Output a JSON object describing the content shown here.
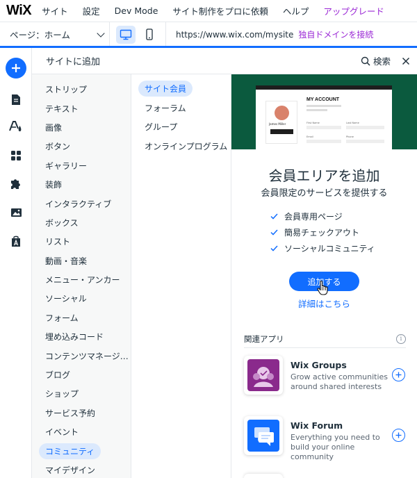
{
  "topbar": {
    "logo": "WiX",
    "menu": [
      "サイト",
      "設定",
      "Dev Mode",
      "サイト制作をプロに依頼",
      "ヘルプ"
    ],
    "upgrade_label": "アップグレード",
    "upgrade_color": "#9a27d5"
  },
  "secondbar": {
    "page_label": "ページ：ホーム",
    "url": "https://www.wix.com/mysite",
    "domain_link": "独自ドメインを接続",
    "active_device": "desktop"
  },
  "accent_color": "#116dff",
  "left_tools": [
    "plus-icon",
    "pages-icon",
    "design-icon",
    "add-apps-icon",
    "puzzle-icon",
    "media-icon",
    "app-market-icon"
  ],
  "panel": {
    "title": "サイトに追加",
    "search_label": "検索",
    "categories": [
      "ストリップ",
      "テキスト",
      "画像",
      "ボタン",
      "ギャラリー",
      "装飾",
      "インタラクティブ",
      "ボックス",
      "リスト",
      "動画・音楽",
      "メニュー・アンカー",
      "ソーシャル",
      "フォーム",
      "埋め込みコード",
      "コンテンツマネージ…",
      "ブログ",
      "ショップ",
      "サービス予約",
      "イベント",
      "コミュニティ",
      "マイデザイン"
    ],
    "active_category": "コミュニティ",
    "subcategories": [
      "サイト会員",
      "フォーラム",
      "グループ",
      "オンラインプログラム"
    ],
    "active_subcategory": "サイト会員",
    "detail": {
      "mock": {
        "title": "MY ACCOUNT",
        "name": "James Miller",
        "button": "Update Info",
        "field_labels": [
          "First Name",
          "Last Name",
          "Email",
          "Phone"
        ]
      },
      "title": "会員エリアを追加",
      "subtitle": "会員限定のサービスを提供する",
      "features": [
        "会員専用ページ",
        "簡易チェックアウト",
        "ソーシャルコミュニティ"
      ],
      "cta": "追加する",
      "more_link": "詳細はこちら",
      "related_title": "関連アプリ",
      "apps": [
        {
          "name": "Wix Groups",
          "desc": "Grow active communities around shared interests",
          "icon": "groups-icon",
          "color": "#8a2a8c"
        },
        {
          "name": "Wix Forum",
          "desc": "Everything you need to build your online community",
          "icon": "forum-icon",
          "color": "#116dff"
        }
      ]
    }
  }
}
